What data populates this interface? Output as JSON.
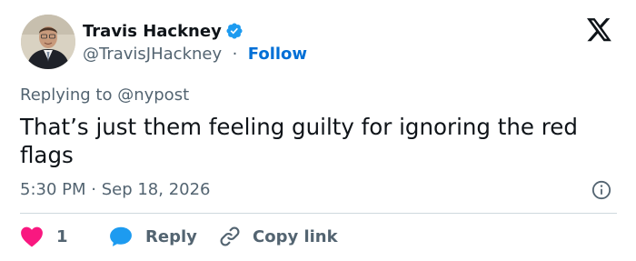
{
  "author": {
    "name": "Travis Hackney",
    "handle": "@TravisJHackney",
    "separator": "·",
    "follow_label": "Follow",
    "verified_color": "#1d9bf0"
  },
  "tweet": {
    "replying_to": "Replying to @nypost",
    "text": "That’s just them feeling guilty for ignoring the red flags",
    "timestamp": "5:30 PM · Sep 18, 2026"
  },
  "actions": {
    "like_count": "1",
    "like_color": "#f91880",
    "reply_label": "Reply",
    "reply_color": "#1d9bf0",
    "copy_label": "Copy link"
  },
  "icons": {
    "brand": "x-logo",
    "info": "info-circle-icon",
    "like": "heart-icon",
    "reply": "speech-bubble-icon",
    "copy": "link-icon"
  }
}
